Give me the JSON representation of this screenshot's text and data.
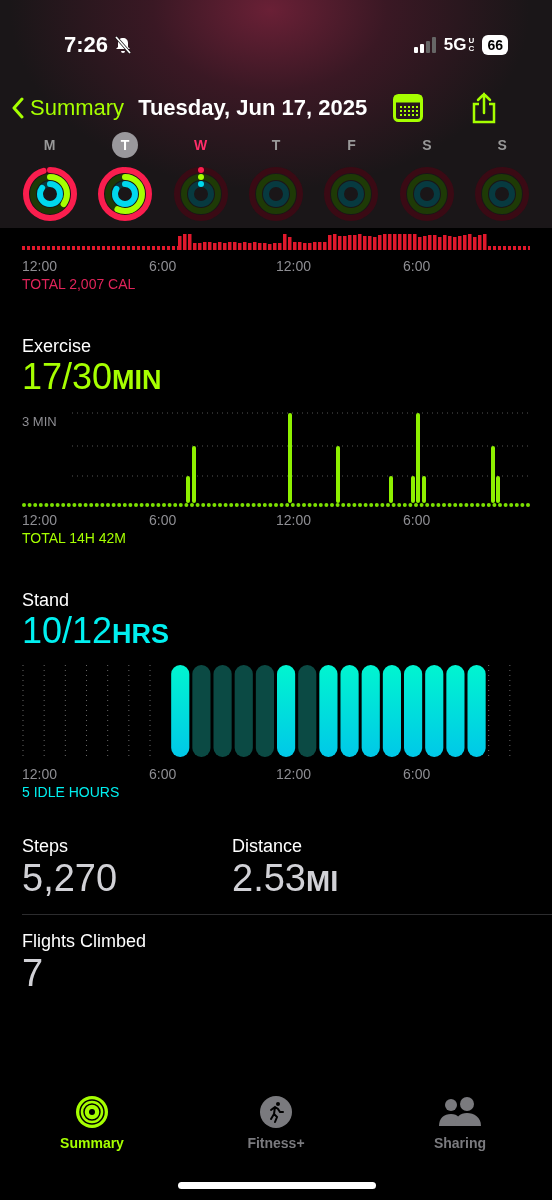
{
  "status_bar": {
    "time": "7:26",
    "network": "5G",
    "network_badge": "UC",
    "battery": "66"
  },
  "nav": {
    "back_label": "Summary",
    "title": "Tuesday, Jun 17, 2025"
  },
  "week": [
    {
      "letter": "M",
      "selected": false,
      "today": false,
      "kind": "active"
    },
    {
      "letter": "T",
      "selected": true,
      "today": false,
      "kind": "active"
    },
    {
      "letter": "W",
      "selected": false,
      "today": true,
      "kind": "started"
    },
    {
      "letter": "T",
      "selected": false,
      "today": false,
      "kind": "empty"
    },
    {
      "letter": "F",
      "selected": false,
      "today": false,
      "kind": "empty"
    },
    {
      "letter": "S",
      "selected": false,
      "today": false,
      "kind": "empty"
    },
    {
      "letter": "S",
      "selected": false,
      "today": false,
      "kind": "empty"
    }
  ],
  "move": {
    "axis_labels": [
      "12:00",
      "6:00",
      "12:00",
      "6:00"
    ],
    "total": "TOTAL 2,007 CAL"
  },
  "exercise": {
    "title": "Exercise",
    "value": "17/30",
    "unit": "MIN",
    "gridline_label": "3 MIN",
    "axis_labels": [
      "12:00",
      "6:00",
      "12:00",
      "6:00"
    ],
    "total": "TOTAL 14H 42M"
  },
  "stand": {
    "title": "Stand",
    "value": "10/12",
    "unit": "HRS",
    "axis_labels": [
      "12:00",
      "6:00",
      "12:00",
      "6:00"
    ],
    "total": "5 IDLE HOURS",
    "hours": [
      {
        "kind": "none"
      },
      {
        "kind": "none"
      },
      {
        "kind": "none"
      },
      {
        "kind": "none"
      },
      {
        "kind": "none"
      },
      {
        "kind": "none"
      },
      {
        "kind": "none"
      },
      {
        "kind": "stood"
      },
      {
        "kind": "idle"
      },
      {
        "kind": "idle"
      },
      {
        "kind": "idle"
      },
      {
        "kind": "idle"
      },
      {
        "kind": "stood"
      },
      {
        "kind": "idle"
      },
      {
        "kind": "stood"
      },
      {
        "kind": "stood"
      },
      {
        "kind": "stood"
      },
      {
        "kind": "stood"
      },
      {
        "kind": "stood"
      },
      {
        "kind": "stood"
      },
      {
        "kind": "stood"
      },
      {
        "kind": "stood"
      },
      {
        "kind": "none"
      },
      {
        "kind": "none"
      }
    ]
  },
  "stats": [
    {
      "label": "Steps",
      "value": "5,270"
    },
    {
      "label": "Distance",
      "value": "2.53",
      "unit": "MI"
    }
  ],
  "flights": {
    "label": "Flights Climbed",
    "value": "7"
  },
  "tabs": [
    {
      "label": "Summary",
      "selected": true
    },
    {
      "label": "Fitness+",
      "selected": false
    },
    {
      "label": "Sharing",
      "selected": false
    }
  ]
}
